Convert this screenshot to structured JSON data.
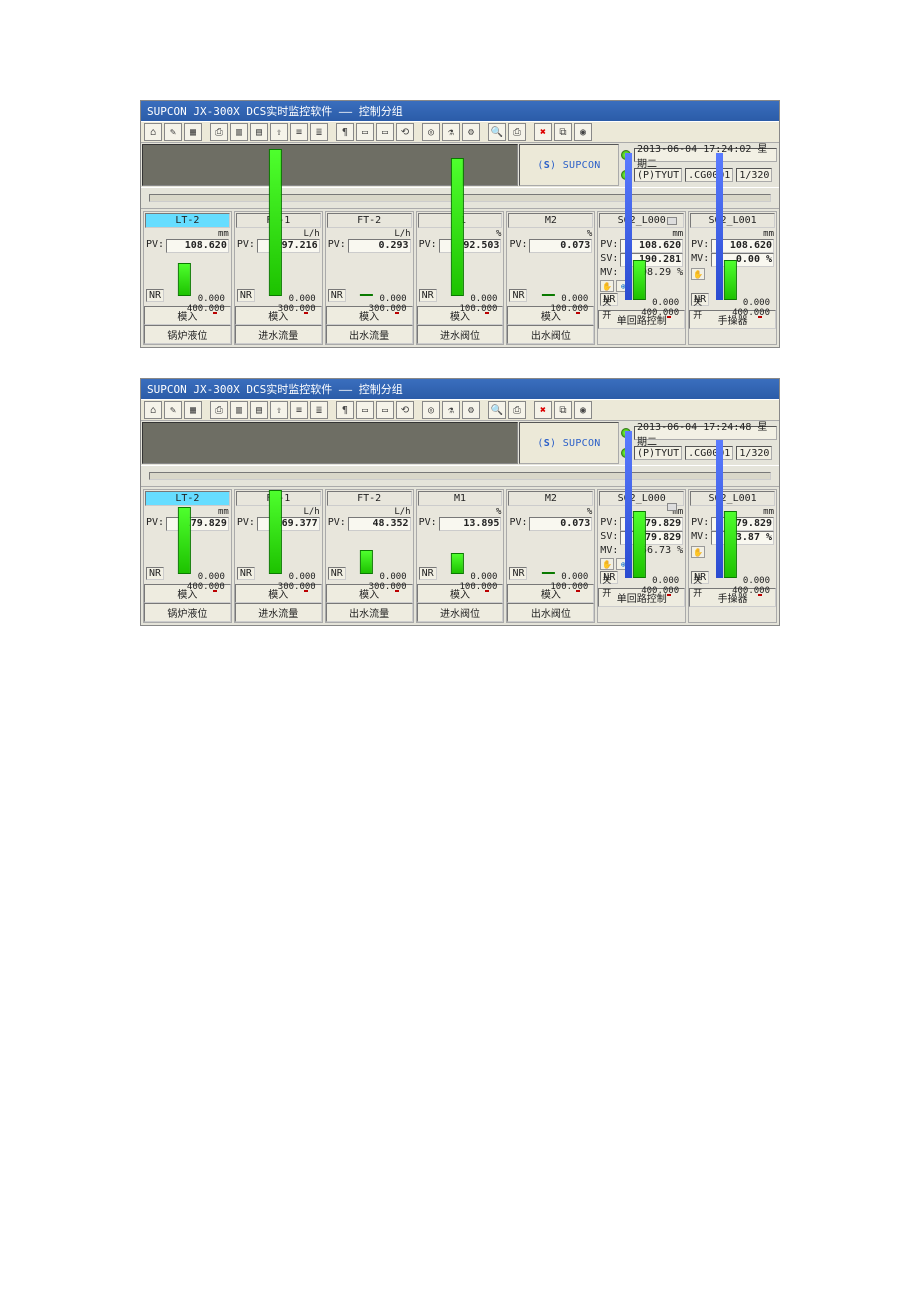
{
  "windows": [
    {
      "title": "SUPCON JX-300X DCS实时监控软件 —— 控制分组",
      "datetime": "2013-06-04 17:24:02 星期二",
      "station": "(P)TYUT",
      "group": ".CG0001",
      "page": "1/320",
      "panels": [
        {
          "name": "LT-2",
          "hl": true,
          "unit": "mm",
          "pv": "108.620",
          "nr": "NR",
          "max": "400.000",
          "min": "0.000",
          "fill": 22,
          "type": "模入",
          "desc": "锅炉液位"
        },
        {
          "name": "FT-1",
          "unit": "L/h",
          "pv": "297.216",
          "nr": "NR",
          "max": "300.000",
          "min": "0.000",
          "fill": 98,
          "type": "模入",
          "desc": "进水流量"
        },
        {
          "name": "FT-2",
          "unit": "L/h",
          "pv": "0.293",
          "nr": "NR",
          "max": "300.000",
          "min": "0.000",
          "fill": 0.3,
          "type": "模入",
          "desc": "出水流量"
        },
        {
          "name": "M1",
          "unit": "%",
          "pv": "92.503",
          "nr": "NR",
          "max": "100.000",
          "min": "0.000",
          "fill": 92,
          "type": "模入",
          "desc": "进水阀位"
        },
        {
          "name": "M2",
          "unit": "%",
          "pv": "0.073",
          "nr": "NR",
          "max": "100.000",
          "min": "0.000",
          "fill": 0.3,
          "type": "模入",
          "desc": "出水阀位"
        },
        {
          "name": "S02_L000",
          "unit": "mm",
          "pv": "108.620",
          "sv": "190.281",
          "mv": "98.29 %",
          "nr": "NR",
          "max": "400.000",
          "min": "0.000",
          "open": "开",
          "close": "关",
          "gfill": 27,
          "bfill": 98,
          "slider": 50,
          "type": "单回路控制",
          "icons": true
        },
        {
          "name": "S02_L001",
          "unit": "mm",
          "pv": "108.620",
          "mv": "0.00 %",
          "mvInput": true,
          "nr": "NR",
          "max": "400.000",
          "min": "0.000",
          "open": "开",
          "close": "关",
          "gfill": 27,
          "bfill": 98,
          "type": "手操器",
          "icons1": true
        }
      ]
    },
    {
      "title": "SUPCON JX-300X DCS实时监控软件 —— 控制分组",
      "datetime": "2013-06-04 17:24:48 星期二",
      "station": "(P)TYUT",
      "group": ".CG0001",
      "page": "1/320",
      "panels": [
        {
          "name": "LT-2",
          "hl": true,
          "unit": "mm",
          "pv": "179.829",
          "nr": "NR",
          "max": "400.000",
          "min": "0.000",
          "fill": 45,
          "type": "模入",
          "desc": "锅炉液位"
        },
        {
          "name": "FT-1",
          "unit": "L/h",
          "pv": "169.377",
          "nr": "NR",
          "max": "300.000",
          "min": "0.000",
          "fill": 56,
          "type": "模入",
          "desc": "进水流量"
        },
        {
          "name": "FT-2",
          "unit": "L/h",
          "pv": "48.352",
          "nr": "NR",
          "max": "300.000",
          "min": "0.000",
          "fill": 16,
          "type": "模入",
          "desc": "出水流量"
        },
        {
          "name": "M1",
          "unit": "%",
          "pv": "13.895",
          "nr": "NR",
          "max": "100.000",
          "min": "0.000",
          "fill": 14,
          "type": "模入",
          "desc": "进水阀位"
        },
        {
          "name": "M2",
          "unit": "%",
          "pv": "0.073",
          "nr": "NR",
          "max": "100.000",
          "min": "0.000",
          "fill": 0.3,
          "type": "模入",
          "desc": "出水阀位"
        },
        {
          "name": "S02_L000",
          "unit": "mm",
          "pv": "179.829",
          "sv": "179.829",
          "mv": "56.73 %",
          "nr": "NR",
          "max": "400.000",
          "min": "0.000",
          "open": "开",
          "close": "关",
          "gfill": 45,
          "bfill": 98,
          "slider": 45,
          "type": "单回路控制",
          "icons": true
        },
        {
          "name": "S02_L001",
          "unit": "mm",
          "pv": "179.829",
          "mv": "53.87 %",
          "mvInput": true,
          "nr": "NR",
          "max": "400.000",
          "min": "0.000",
          "open": "开",
          "close": "关",
          "gfill": 45,
          "bfill": 92,
          "type": "手操器",
          "icons1": true
        }
      ]
    }
  ],
  "toolbar_icons": [
    "home",
    "wrench",
    "grid",
    "print",
    "page1",
    "page2",
    "arrow-up",
    "lines1",
    "lines2",
    "pilcrow",
    "book1",
    "book2",
    "undo",
    "target",
    "flask",
    "gear",
    "binoc",
    "printer",
    "close",
    "copy",
    "camera"
  ],
  "brand": "SUPCON"
}
